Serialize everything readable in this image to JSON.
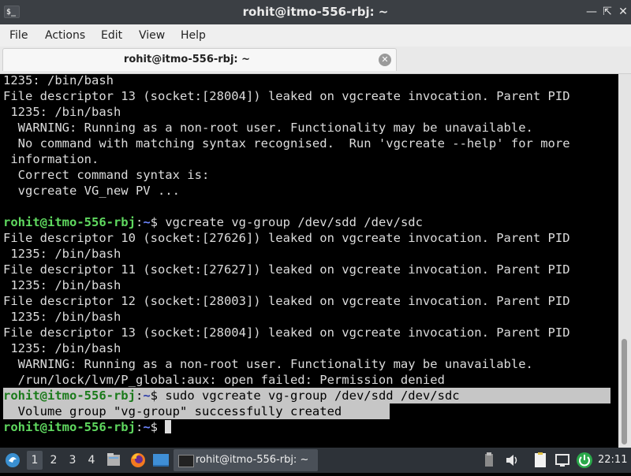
{
  "window": {
    "title": "rohit@itmo-556-rbj: ~",
    "app_icon_glyph": "$_"
  },
  "menu": [
    "File",
    "Actions",
    "Edit",
    "View",
    "Help"
  ],
  "tab": {
    "label": "rohit@itmo-556-rbj: ~"
  },
  "prompt": {
    "user": "rohit@itmo-556-rbj",
    "sep": ":",
    "path": "~",
    "symbol": "$ "
  },
  "terminal_lines": [
    "1235: /bin/bash",
    "File descriptor 13 (socket:[28004]) leaked on vgcreate invocation. Parent PID",
    " 1235: /bin/bash",
    "  WARNING: Running as a non-root user. Functionality may be unavailable.",
    "  No command with matching syntax recognised.  Run 'vgcreate --help' for more",
    " information.",
    "  Correct command syntax is:",
    "  vgcreate VG_new PV ...",
    "",
    "",
    "File descriptor 10 (socket:[27626]) leaked on vgcreate invocation. Parent PID",
    " 1235: /bin/bash",
    "File descriptor 11 (socket:[27627]) leaked on vgcreate invocation. Parent PID",
    " 1235: /bin/bash",
    "File descriptor 12 (socket:[28003]) leaked on vgcreate invocation. Parent PID",
    " 1235: /bin/bash",
    "File descriptor 13 (socket:[28004]) leaked on vgcreate invocation. Parent PID",
    " 1235: /bin/bash",
    "  WARNING: Running as a non-root user. Functionality may be unavailable.",
    "  /run/lock/lvm/P_global:aux: open failed: Permission denied",
    "",
    "  Volume group \"vg-group\" successfully created",
    ""
  ],
  "commands": {
    "cmd1": "vgcreate vg-group /dev/sdd /dev/sdc",
    "cmd2": "sudo vgcreate vg-group /dev/sdd /dev/sdc"
  },
  "taskbar": {
    "workspaces": [
      "1",
      "2",
      "3",
      "4"
    ],
    "task_label": "rohit@itmo-556-rbj: ~",
    "clock": "22:11"
  },
  "colors": {
    "prompt_user": "#5fd85f",
    "prompt_path": "#6e86ff",
    "selection": "#c6c6c6",
    "taskbar": "#2d3238"
  }
}
